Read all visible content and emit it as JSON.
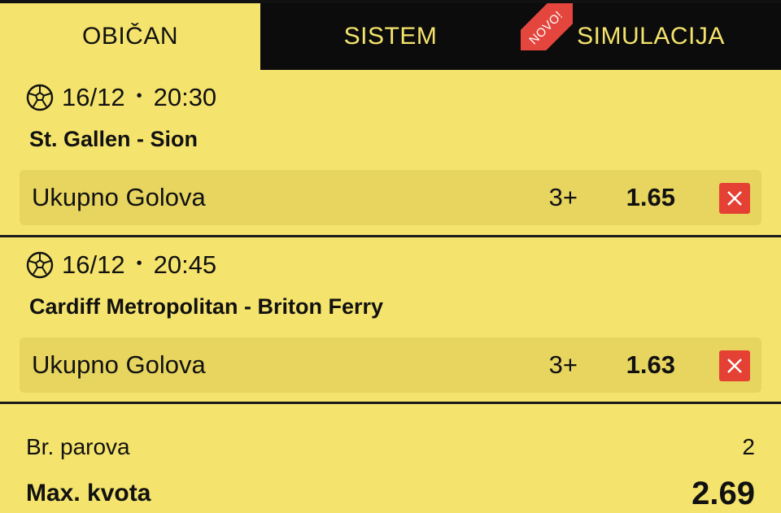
{
  "tabs": [
    {
      "label": "OBIČAN",
      "active": true
    },
    {
      "label": "SISTEM",
      "active": false
    },
    {
      "label": "SIMULACIJA",
      "active": false,
      "badge": "NOVO!"
    }
  ],
  "matches": [
    {
      "sport_icon": "soccer-ball-icon",
      "date": "16/12",
      "separator": "•",
      "time": "20:30",
      "teams": "St. Gallen - Sion",
      "market": "Ukupno Golova",
      "outcome": "3+",
      "odd": "1.65"
    },
    {
      "sport_icon": "soccer-ball-icon",
      "date": "16/12",
      "separator": "•",
      "time": "20:45",
      "teams": "Cardiff Metropolitan - Briton Ferry",
      "market": "Ukupno Golova",
      "outcome": "3+",
      "odd": "1.63"
    }
  ],
  "summary": {
    "pairs_label": "Br. parova",
    "pairs_value": "2",
    "max_odd_label": "Max. kvota",
    "max_odd_value": "2.69"
  },
  "colors": {
    "background": "#f4e36c",
    "tab_dark": "#0c0c0c",
    "remove_button": "#e54034",
    "badge": "#e4463e"
  }
}
